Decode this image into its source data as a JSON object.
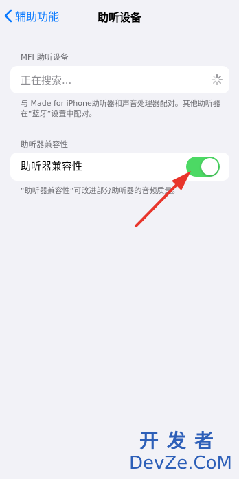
{
  "nav": {
    "back_label": "辅助功能",
    "title": "助听设备"
  },
  "mfi": {
    "section_label": "MFI 助听设备",
    "search_status": "正在搜索...",
    "footnote": "与 Made for iPhone助听器和声音处理器配对。其他助听器在“蓝牙”设置中配对。"
  },
  "compat": {
    "section_label": "助听器兼容性",
    "toggle_label": "助听器兼容性",
    "toggle_on": true,
    "footnote": "“助听器兼容性”可改进部分助听器的音频质量。"
  },
  "colors": {
    "accent": "#0a7aff",
    "toggle_on": "#4cd964",
    "arrow": "#e8352b"
  },
  "watermark": {
    "top": "开发者",
    "bottom": "DevZe.CoM"
  }
}
